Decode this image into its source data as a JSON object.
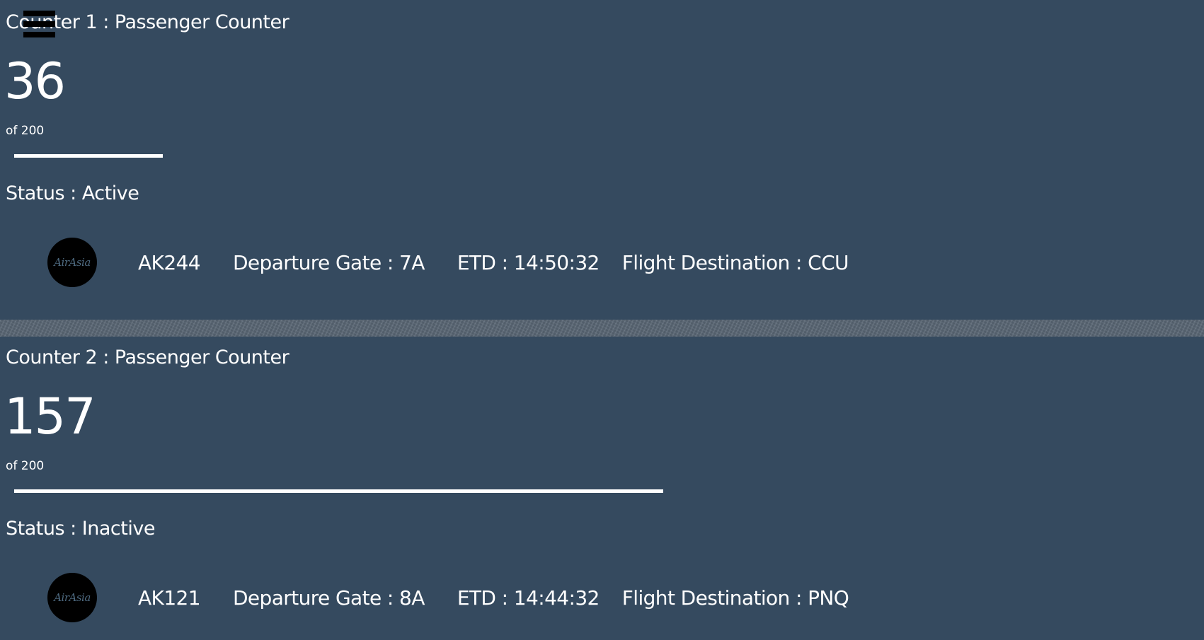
{
  "menu": {
    "icon": "hamburger-menu-icon"
  },
  "counters": [
    {
      "title": "Counter 1 :  Passenger Counter",
      "count": "36",
      "of_total": "of 200",
      "progress": 0.18,
      "status": "Status : Active",
      "logo_text": "AirAsia",
      "flight_code": "AK244",
      "gate": "Departure Gate : 7A",
      "etd": "ETD : 14:50:32",
      "destination": "Flight  Destination : CCU"
    },
    {
      "title": "Counter 2 :  Passenger Counter",
      "count": "157",
      "of_total": "of 200",
      "progress": 0.785,
      "status": "Status :  Inactive",
      "logo_text": "AirAsia",
      "flight_code": "AK121",
      "gate": "Departure Gate : 8A",
      "etd": "ETD : 14:44:32",
      "destination": "Flight  Destination :  PNQ"
    }
  ],
  "colors": {
    "background": "#354a5f",
    "text": "#ffffff",
    "divider": "#5a6775"
  }
}
